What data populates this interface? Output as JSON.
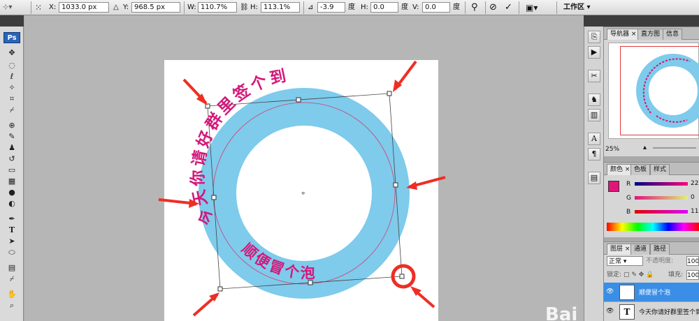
{
  "options_bar": {
    "x_label": "X:",
    "x_value": "1033.0 px",
    "y_label": "Y:",
    "y_value": "968.5 px",
    "w_label": "W:",
    "w_value": "110.7%",
    "h_label": "H:",
    "h_value": "113.1%",
    "angle_value": "-3.9",
    "angle_unit": "度",
    "hskew_label": "H:",
    "hskew_value": "0.0",
    "hskew_unit": "度",
    "vskew_label": "V:",
    "vskew_value": "0.0",
    "vskew_unit": "度",
    "workspace_label": "工作区"
  },
  "tools": {
    "ps_logo": "Ps",
    "type_tool": "T"
  },
  "canvas": {
    "arc_text_top": "今天你请好群里签个到",
    "arc_text_bottom": "顺便冒个泡",
    "ring_color": "#7ecbec",
    "text_color": "#d4187a",
    "arrow_color": "#ee2e24"
  },
  "navigator_panel": {
    "tabs": [
      "导航器",
      "直方图",
      "信息"
    ],
    "zoom_value": "25%"
  },
  "color_panel": {
    "tabs": [
      "颜色",
      "色板",
      "样式"
    ],
    "r_label": "R",
    "r_value": "22",
    "g_label": "G",
    "g_value": "0",
    "b_label": "B",
    "b_value": "11",
    "foreground_color": "#e0157a"
  },
  "layers_panel": {
    "tabs": [
      "图层",
      "通道",
      "路径"
    ],
    "blend_mode": "正常",
    "opacity_label": "不透明度:",
    "opacity_value": "100",
    "lock_label": "锁定:",
    "fill_label": "填充:",
    "fill_value": "100",
    "layers": [
      {
        "thumb": "T",
        "name": "顺便冒个泡"
      },
      {
        "thumb": "T",
        "name": "今天你请好群里签个到"
      }
    ]
  },
  "watermark": "Bai"
}
